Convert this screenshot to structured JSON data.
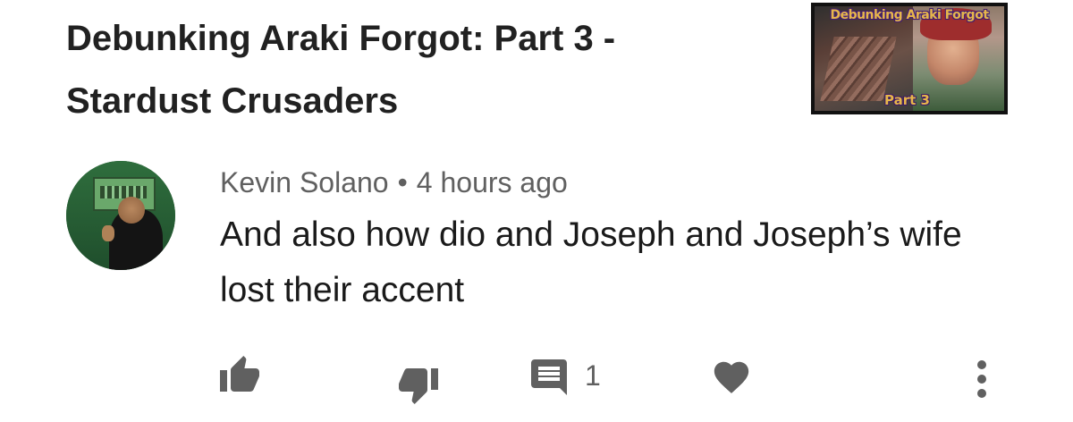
{
  "video": {
    "title_line1": "Debunking Araki Forgot: Part 3 -",
    "title_line2": "Stardust Crusaders",
    "thumbnail": {
      "banner_text": "Debunking Araki Forgot",
      "part_text": "Part 3"
    }
  },
  "comment": {
    "author": "Kevin Solano",
    "separator": "•",
    "time": "4 hours ago",
    "text": "And also how dio and Joseph and Joseph’s wife lost their accent"
  },
  "actions": {
    "like_icon": "thumbs-up-icon",
    "dislike_icon": "thumbs-down-icon",
    "reply_icon": "comment-icon",
    "reply_count": "1",
    "heart_icon": "heart-icon",
    "more_icon": "more-vertical-icon"
  },
  "colors": {
    "text_primary": "#212121",
    "text_secondary": "#606060",
    "icon_gray": "#606060",
    "background": "#ffffff"
  }
}
